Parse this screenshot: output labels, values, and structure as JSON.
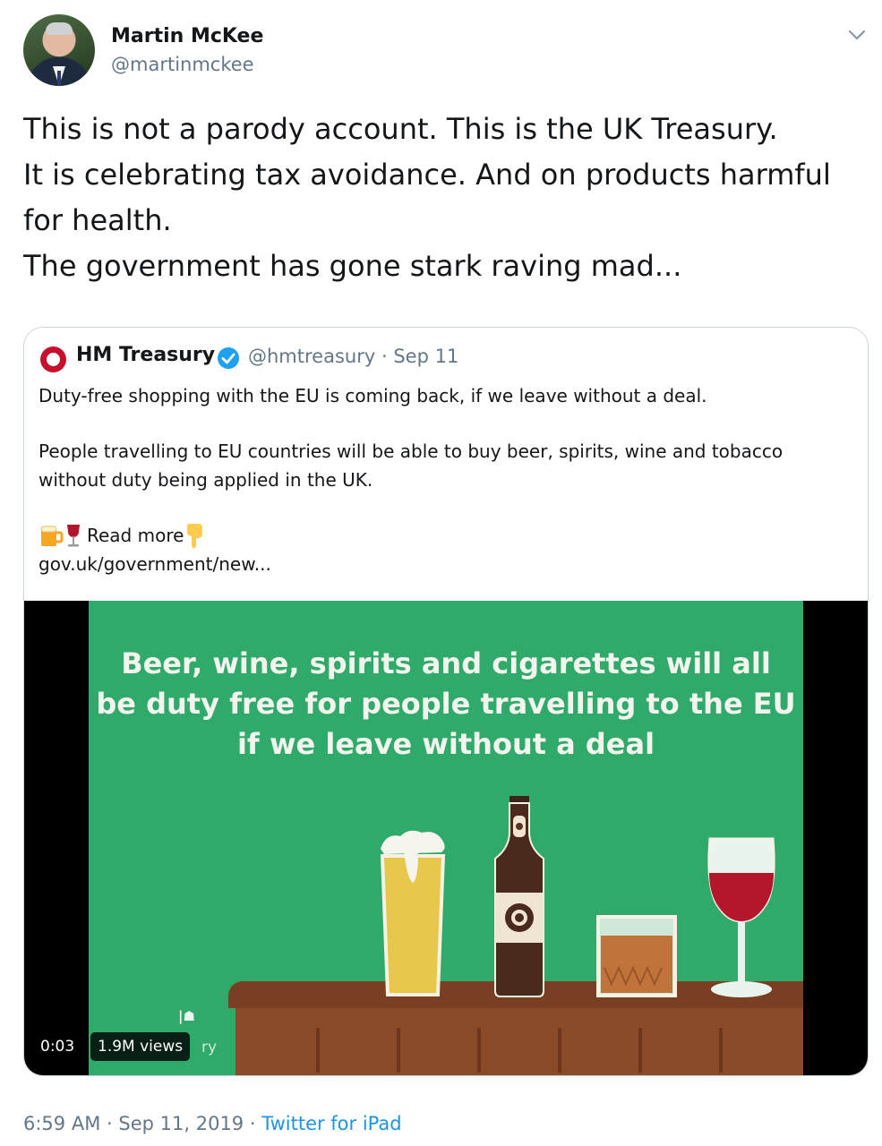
{
  "author": {
    "name": "Martin McKee",
    "handle": "@martinmckee"
  },
  "tweet": {
    "lines": [
      "This is not a parody account. This is the UK Treasury.",
      "It is celebrating tax avoidance. And on products harmful",
      "for health.",
      "The government has gone stark raving mad..."
    ]
  },
  "quoted": {
    "name": "HM Treasury",
    "handle": "@hmtreasury",
    "separator": "·",
    "date": "Sep 11",
    "paragraph1": "Duty-free shopping with the EU is coming back, if we leave without a deal.",
    "paragraph2_line1": "People travelling to EU countries will be able to buy beer, spirits, wine and tobacco",
    "paragraph2_line2": "without duty being applied in the UK.",
    "read_more": "Read more",
    "link": "gov.uk/government/new...",
    "emojis": [
      "beer-mug-icon",
      "wine-glass-icon",
      "pointing-down-icon"
    ],
    "media": {
      "caption_lines": [
        "Beer, wine, spirits and cigarettes will all",
        "be duty free for people travelling to the EU",
        "if we leave without a deal"
      ],
      "time": "0:03",
      "views": "1.9M views",
      "partial_text": "ry",
      "background_color": "#2faa6b"
    }
  },
  "footer": {
    "time": "6:59 AM",
    "separator": "·",
    "date": "Sep 11, 2019",
    "source": "Twitter for iPad"
  },
  "colors": {
    "link": "#1b95e0",
    "muted": "#657786",
    "verified": "#1da1f2"
  }
}
